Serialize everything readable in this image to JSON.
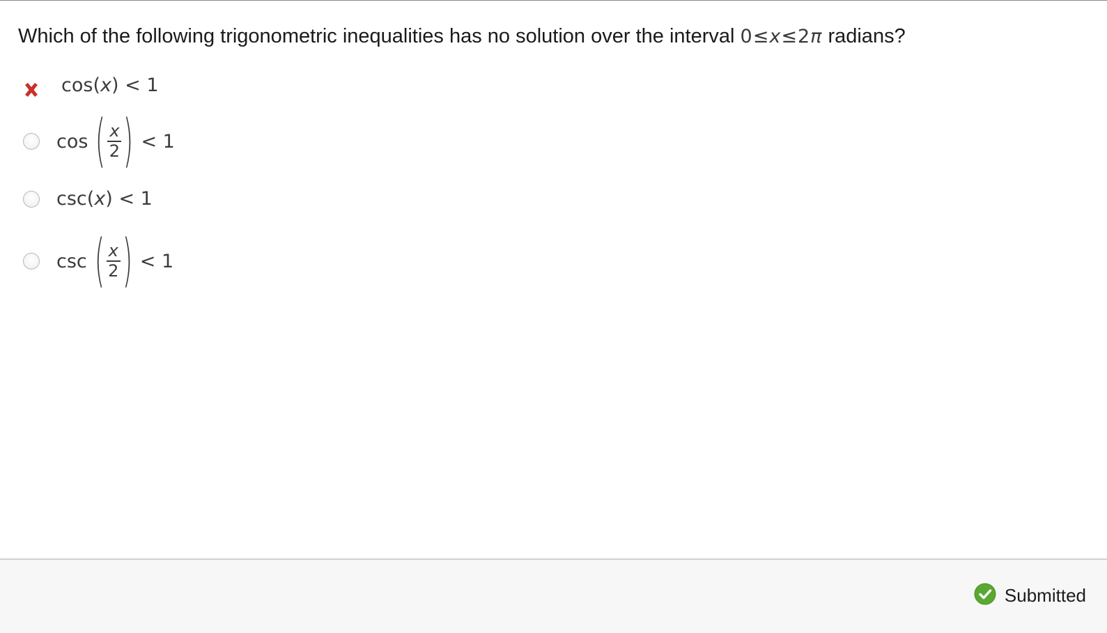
{
  "question": {
    "text_before": "Which of the following trigonometric inequalities has no solution over the interval",
    "interval": {
      "lower": "0",
      "rel1": "≤",
      "var": "x",
      "rel2": "≤",
      "upper_num": "2",
      "upper_sym": "π"
    },
    "text_after": "radians?"
  },
  "options": [
    {
      "func": "cos",
      "open": "(",
      "arg": "x",
      "close": ")",
      "relation": "<",
      "rhs": "1",
      "state": "selected-incorrect"
    },
    {
      "func": "cos",
      "numerator": "x",
      "denominator": "2",
      "relation": "<",
      "rhs": "1",
      "state": "unselected"
    },
    {
      "func": "csc",
      "open": "(",
      "arg": "x",
      "close": ")",
      "relation": "<",
      "rhs": "1",
      "state": "unselected"
    },
    {
      "func": "csc",
      "numerator": "x",
      "denominator": "2",
      "relation": "<",
      "rhs": "1",
      "state": "unselected"
    }
  ],
  "footer": {
    "status_label": "Submitted",
    "status_icon": "check-circle-icon",
    "status_color": "#5aa832"
  },
  "colors": {
    "incorrect_mark": "#c8322b",
    "text": "#1a1a1a",
    "math_text": "#3c3c3c"
  },
  "icons": {
    "incorrect": "x-mark-icon",
    "radio": "radio-button-icon"
  }
}
